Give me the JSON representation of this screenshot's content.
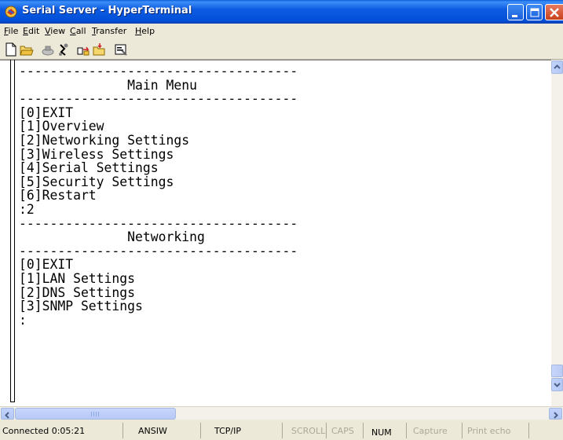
{
  "window": {
    "title": "Serial Server - HyperTerminal"
  },
  "menu": {
    "file": {
      "accel": "F",
      "rest": "ile"
    },
    "edit": {
      "accel": "E",
      "rest": "dit"
    },
    "view": {
      "accel": "V",
      "rest": "iew"
    },
    "call": {
      "accel": "C",
      "rest": "all"
    },
    "transfer": {
      "accel": "T",
      "rest": "ransfer"
    },
    "help": {
      "accel": "H",
      "rest": "elp"
    }
  },
  "toolbar": {
    "icons": [
      "new-icon",
      "open-icon",
      "connect-icon",
      "disconnect-icon",
      "send-icon",
      "receive-icon",
      "properties-icon"
    ]
  },
  "terminal": {
    "lines": [
      "------------------------------------",
      "              Main Menu",
      "------------------------------------",
      "[0]EXIT",
      "[1]Overview",
      "[2]Networking Settings",
      "[3]Wireless Settings",
      "[4]Serial Settings",
      "[5]Security Settings",
      "[6]Restart",
      ":2",
      "------------------------------------",
      "              Networking",
      "------------------------------------",
      "[0]EXIT",
      "[1]LAN Settings",
      "[2]DNS Settings",
      "[3]SNMP Settings",
      ":"
    ]
  },
  "status": {
    "connected": "Connected 0:05:21",
    "emulation": "ANSIW",
    "protocol": "TCP/IP",
    "scroll": "SCROLL",
    "caps": "CAPS",
    "num": "NUM",
    "capture": "Capture",
    "print_echo": "Print echo"
  },
  "colors": {
    "titlebar": "#0054e3",
    "close_button": "#c8401e",
    "terminal_background": "#ffffff",
    "terminal_text": "#000000",
    "status_inactive": "#aca899"
  }
}
